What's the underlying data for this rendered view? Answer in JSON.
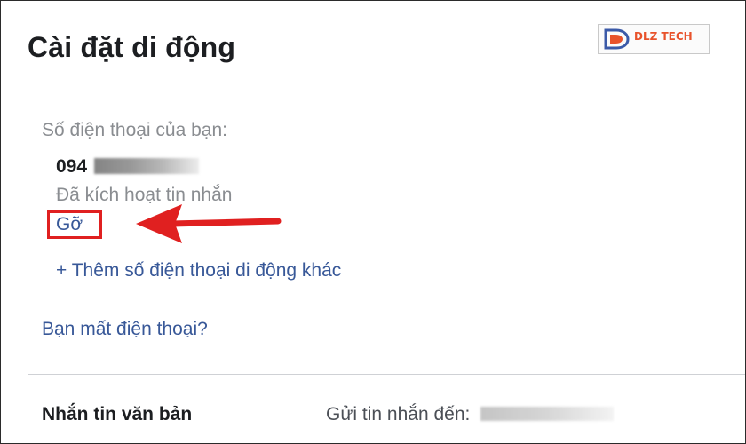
{
  "page": {
    "title": "Cài đặt di động"
  },
  "logo": {
    "brand": "DLZ TECH",
    "accent_color": "#e8522b"
  },
  "phones": {
    "label": "Số điện thoại của bạn:",
    "number_visible": "094",
    "status": "Đã kích hoạt tin nhắn",
    "remove_label": "Gỡ",
    "add_label": "+ Thêm số điện thoại di động khác"
  },
  "lost_phone_label": "Bạn mất điện thoại?",
  "text_messaging": {
    "title": "Nhắn tin văn bản",
    "send_to_label": "Gửi tin nhắn đến:"
  },
  "annotation": {
    "highlight_color": "#e02020"
  },
  "colors": {
    "link": "#385898",
    "muted": "#8a8d91",
    "heading": "#1c1e21"
  }
}
